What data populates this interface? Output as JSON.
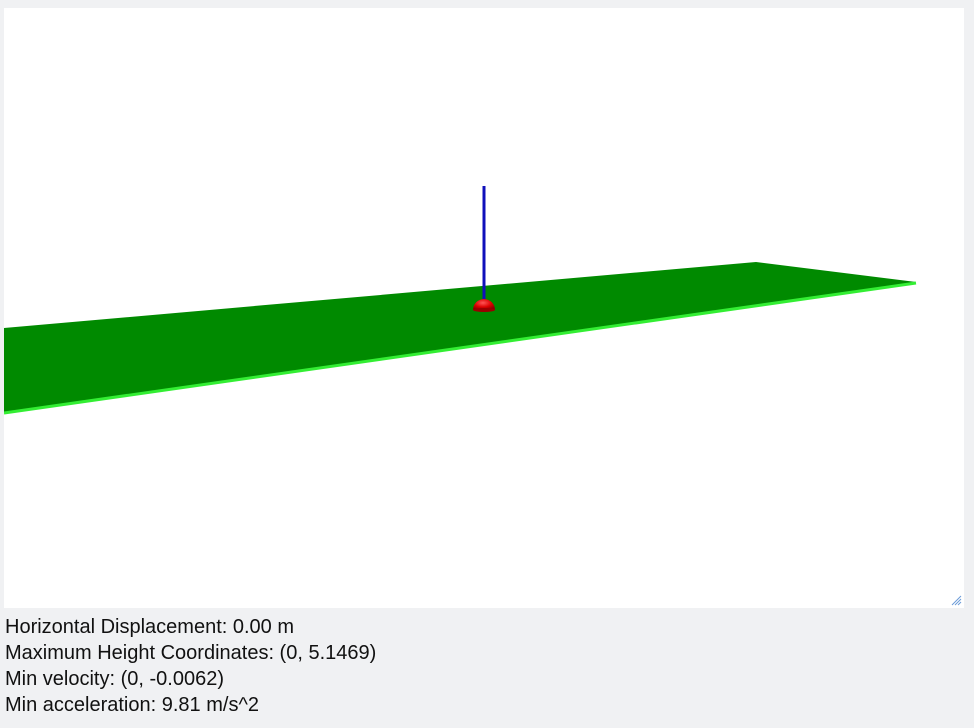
{
  "scene": {
    "ground_color": "#008a00",
    "ground_edge_color": "#33ee33",
    "ball_color": "#dd0000",
    "vector_color": "#1010bb",
    "background_color": "#ffffff",
    "ground_label": "ground-plane",
    "projectile_label": "projectile-ball",
    "velocity_label": "velocity-arrow"
  },
  "readouts": {
    "horizontal_displacement": "Horizontal Displacement: 0.00 m",
    "max_height": "Maximum Height Coordinates: (0, 5.1469)",
    "min_velocity": "Min velocity: (0, -0.0062)",
    "min_acceleration": "Min acceleration: 9.81 m/s^2"
  },
  "icons": {
    "resize_handle": "resize-grip-icon"
  }
}
